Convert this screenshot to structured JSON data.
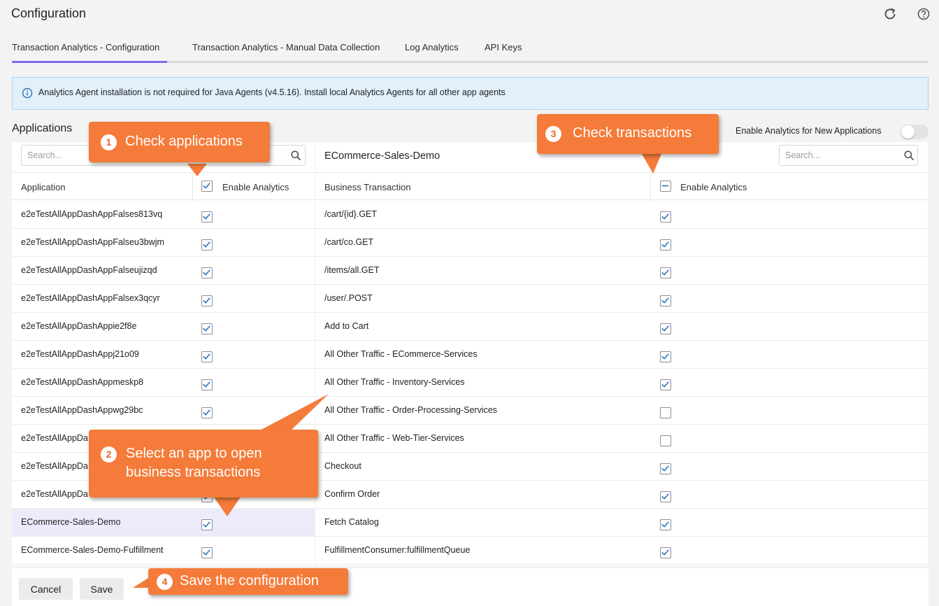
{
  "header": {
    "title": "Configuration",
    "refresh_icon": "refresh-icon",
    "help_icon": "help-icon"
  },
  "tabs": [
    {
      "label": "Transaction Analytics - Configuration",
      "active": true
    },
    {
      "label": "Transaction Analytics - Manual Data Collection",
      "active": false
    },
    {
      "label": "Log Analytics",
      "active": false
    },
    {
      "label": "API Keys",
      "active": false
    }
  ],
  "banner": {
    "icon": "info-icon",
    "text": "Analytics Agent installation is not required for Java Agents (v4.5.16). Install local Analytics Agents for all other app agents"
  },
  "applications": {
    "title": "Applications",
    "search_placeholder": "Search...",
    "col_application": "Application",
    "col_enable": "Enable Analytics",
    "header_checked": true,
    "rows": [
      {
        "name": "e2eTestAllAppDashAppFalses813vq",
        "checked": true
      },
      {
        "name": "e2eTestAllAppDashAppFalseu3bwjm",
        "checked": true
      },
      {
        "name": "e2eTestAllAppDashAppFalseujizqd",
        "checked": true
      },
      {
        "name": "e2eTestAllAppDashAppFalsex3qcyr",
        "checked": true
      },
      {
        "name": "e2eTestAllAppDashAppie2f8e",
        "checked": true
      },
      {
        "name": "e2eTestAllAppDashAppj21o09",
        "checked": true
      },
      {
        "name": "e2eTestAllAppDashAppmeskp8",
        "checked": true
      },
      {
        "name": "e2eTestAllAppDashAppwg29bc",
        "checked": true
      },
      {
        "name": "e2eTestAllAppDa",
        "checked": true
      },
      {
        "name": "e2eTestAllAppDa",
        "checked": true
      },
      {
        "name": "e2eTestAllAppDa",
        "checked": true
      },
      {
        "name": "ECommerce-Sales-Demo",
        "checked": true,
        "selected": true
      },
      {
        "name": "ECommerce-Sales-Demo-Fulfillment",
        "checked": true
      }
    ]
  },
  "new_apps_toggle": {
    "label": "Enable Analytics for New Applications",
    "on": false
  },
  "transactions": {
    "app_title": "ECommerce-Sales-Demo",
    "search_placeholder": "Search...",
    "col_bt": "Business Transaction",
    "col_enable": "Enable Analytics",
    "header_state": "indeterminate",
    "rows": [
      {
        "name": "/cart/{id}.GET",
        "checked": true
      },
      {
        "name": "/cart/co.GET",
        "checked": true
      },
      {
        "name": "/items/all.GET",
        "checked": true
      },
      {
        "name": "/user/.POST",
        "checked": true
      },
      {
        "name": "Add to Cart",
        "checked": true
      },
      {
        "name": "All Other Traffic - ECommerce-Services",
        "checked": true
      },
      {
        "name": "All Other Traffic - Inventory-Services",
        "checked": true
      },
      {
        "name": "All Other Traffic - Order-Processing-Services",
        "checked": false
      },
      {
        "name": "All Other Traffic - Web-Tier-Services",
        "checked": false
      },
      {
        "name": "Checkout",
        "checked": true
      },
      {
        "name": "Confirm Order",
        "checked": true
      },
      {
        "name": "Fetch Catalog",
        "checked": true
      },
      {
        "name": "FulfillmentConsumer:fulfillmentQueue",
        "checked": true
      }
    ]
  },
  "footer": {
    "cancel_label": "Cancel",
    "save_label": "Save"
  },
  "callouts": [
    {
      "num": "1",
      "text": "Check applications"
    },
    {
      "num": "2",
      "text": "Select an app to open",
      "text2": "business transactions"
    },
    {
      "num": "3",
      "text": "Check transactions"
    },
    {
      "num": "4",
      "text": "Save the configuration"
    }
  ],
  "colors": {
    "accent": "#7b6ef0",
    "callout": "#f47b39",
    "selected_row": "#ecebfc",
    "banner_bg": "#e2f0fc",
    "checkbox_check": "#3f83c9"
  }
}
